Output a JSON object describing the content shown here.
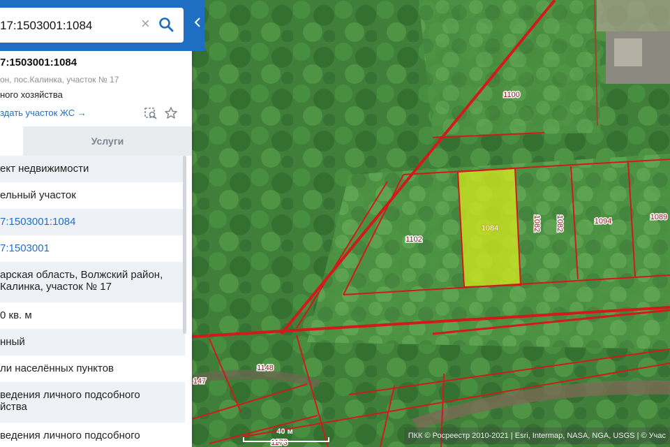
{
  "search": {
    "value": "17:1503001:1084"
  },
  "object": {
    "title": "7:1503001:1084",
    "address": "он, пос.Калинка, участок № 17",
    "usage": "ного хозяйства",
    "create_link": "здать участок ЖС →"
  },
  "tabs": {
    "services": "Услуги"
  },
  "rows": [
    {
      "text": "ект недвижимости"
    },
    {
      "text": "ельный участок"
    },
    {
      "text": "7:1503001:1084"
    },
    {
      "text": "7:1503001"
    },
    {
      "line1": "арская область, Волжский район,",
      "line2": "Калинка, участок № 17"
    },
    {
      "text": "0 кв. м"
    },
    {
      "text": "нный"
    },
    {
      "text": "ли населённых пунктов"
    },
    {
      "line1": "ведения личного подсобного",
      "line2": "йства"
    },
    {
      "text": "ведения личного подсобного"
    }
  ],
  "map": {
    "parcel_labels": {
      "p1100": "1100",
      "p1102": "1102",
      "p1084": "1084",
      "p1082a": "1082",
      "p1082b": "1082",
      "p1094": "1094",
      "p1089": "1089",
      "p1148": "1148",
      "p147": "147",
      "p1173": "1173"
    },
    "selected_parcel": "1084",
    "boundary_color": "#d11a1a",
    "selected_color": "#d6e81e"
  },
  "scale": {
    "label": "40 м"
  },
  "attribution": "ПКК © Росреестр 2010-2021 | Esri, Intermap, NASA, NGA, USGS | © Учас"
}
